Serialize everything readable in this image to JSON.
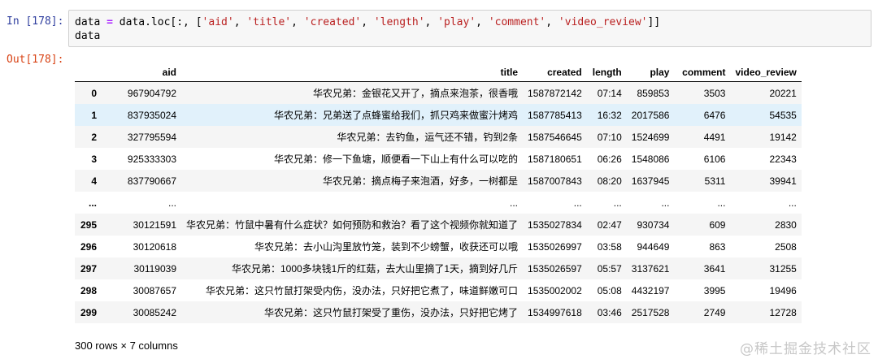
{
  "input_cell": {
    "prompt": "In [178]:",
    "code_line_1": {
      "var": "data ",
      "op": "=",
      "pre": " data.loc[:, [",
      "items": [
        "'aid'",
        "'title'",
        "'created'",
        "'length'",
        "'play'",
        "'comment'",
        "'video_review'"
      ],
      "post": "]]"
    },
    "code_line_2": "data"
  },
  "output_cell": {
    "prompt": "Out[178]:",
    "columns": [
      "aid",
      "title",
      "created",
      "length",
      "play",
      "comment",
      "video_review"
    ],
    "rows": [
      {
        "index": "0",
        "cells": [
          "967904792",
          "华农兄弟：金银花又开了，摘点来泡茶，很香哦",
          "1587872142",
          "07:14",
          "859853",
          "3503",
          "20221"
        ]
      },
      {
        "index": "1",
        "cells": [
          "837935024",
          "华农兄弟：兄弟送了点蜂蜜给我们，抓只鸡来做蜜汁烤鸡",
          "1587785413",
          "16:32",
          "2017586",
          "6476",
          "54535"
        ]
      },
      {
        "index": "2",
        "cells": [
          "327795594",
          "华农兄弟：去钓鱼，运气还不错，钓到2条",
          "1587546645",
          "07:10",
          "1524699",
          "4491",
          "19142"
        ]
      },
      {
        "index": "3",
        "cells": [
          "925333303",
          "华农兄弟：修一下鱼塘，顺便看一下山上有什么可以吃的",
          "1587180651",
          "06:26",
          "1548086",
          "6106",
          "22343"
        ]
      },
      {
        "index": "4",
        "cells": [
          "837790667",
          "华农兄弟：摘点梅子来泡酒，好多，一树都是",
          "1587007843",
          "08:20",
          "1637945",
          "5311",
          "39941"
        ]
      },
      {
        "index": "...",
        "cells": [
          "...",
          "...",
          "...",
          "...",
          "...",
          "...",
          "..."
        ]
      },
      {
        "index": "295",
        "cells": [
          "30121591",
          "华农兄弟：竹鼠中暑有什么症状？如何预防和救治？看了这个视频你就知道了",
          "1535027834",
          "02:47",
          "930734",
          "609",
          "2830"
        ]
      },
      {
        "index": "296",
        "cells": [
          "30120618",
          "华农兄弟：去小山沟里放竹笼，装到不少螃蟹，收获还可以哦",
          "1535026997",
          "03:58",
          "944649",
          "863",
          "2508"
        ]
      },
      {
        "index": "297",
        "cells": [
          "30119039",
          "华农兄弟：1000多块钱1斤的红菇，去大山里摘了1天，摘到好几斤",
          "1535026597",
          "05:57",
          "3137621",
          "3641",
          "31255"
        ]
      },
      {
        "index": "298",
        "cells": [
          "30087657",
          "华农兄弟：这只竹鼠打架受内伤，没办法，只好把它煮了，味道鲜嫩可口",
          "1535002002",
          "05:08",
          "4432197",
          "3995",
          "19496"
        ]
      },
      {
        "index": "299",
        "cells": [
          "30085242",
          "华农兄弟：这只竹鼠打架受了重伤，没办法，只好把它烤了",
          "1534997618",
          "03:46",
          "2517528",
          "2749",
          "12728"
        ]
      }
    ],
    "hovered_row": 1,
    "summary": "300 rows × 7 columns"
  },
  "watermark": "@稀土掘金技术社区",
  "colors": {
    "in_prompt": "#303f9f",
    "out_prompt": "#d84315",
    "string": "#ba2121",
    "operator": "#aa22ff",
    "row_stripe": "#f5f5f5",
    "row_hover": "#e1f1fb"
  }
}
